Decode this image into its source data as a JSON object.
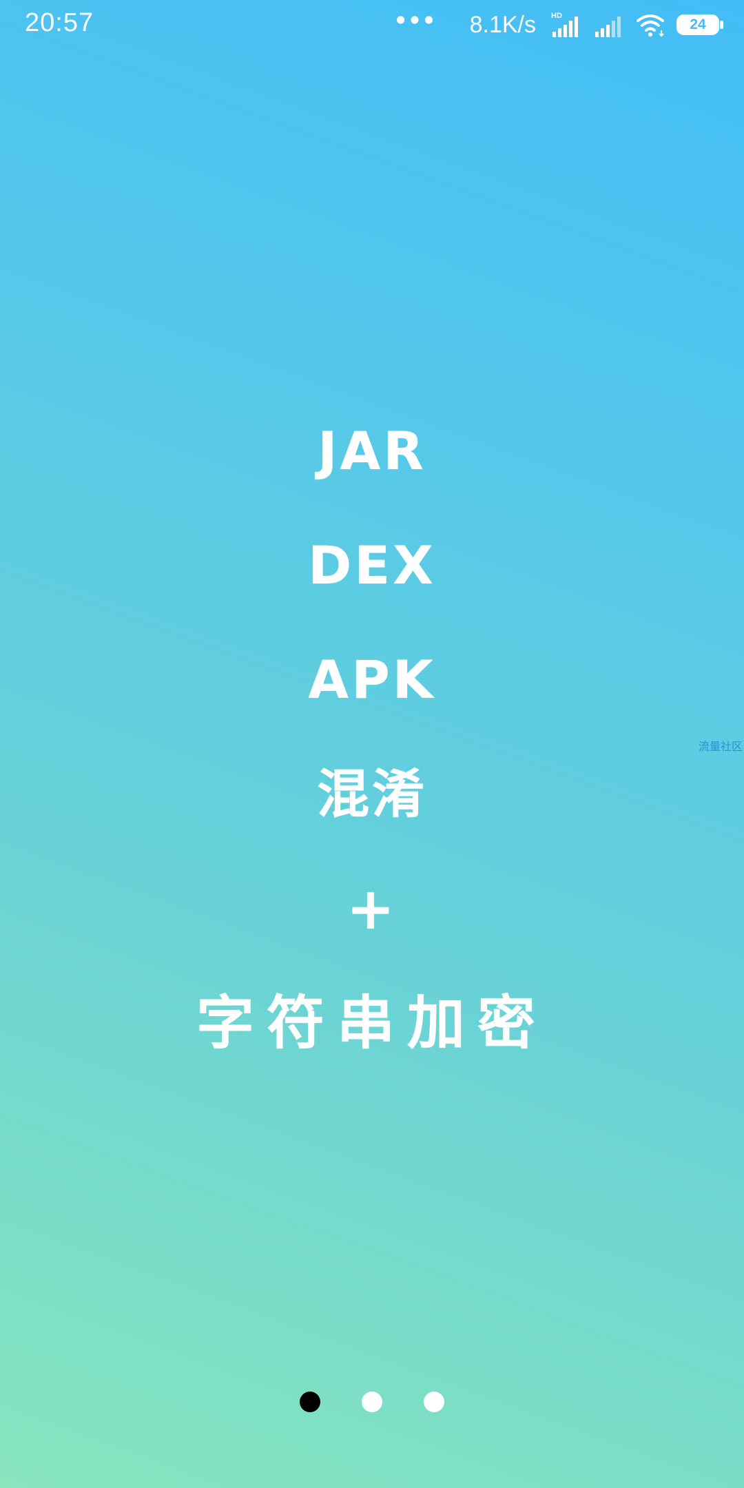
{
  "status_bar": {
    "time": "20:57",
    "more_icon": "more-dots-icon",
    "network_speed": "8.1K/s",
    "signal_label": "HD",
    "battery_level": "24"
  },
  "onboarding": {
    "lines": [
      "JAR",
      "DEX",
      "APK",
      "混淆",
      "+",
      "字符串加密"
    ]
  },
  "watermark": "流量社区",
  "pager": {
    "page_count": 3,
    "current_page": 1
  },
  "colors": {
    "gradient_top": "#42bdf6",
    "gradient_bottom": "#88e5bd",
    "text": "#ffffff",
    "active_dot": "#000000",
    "inactive_dot": "#ffffff"
  }
}
